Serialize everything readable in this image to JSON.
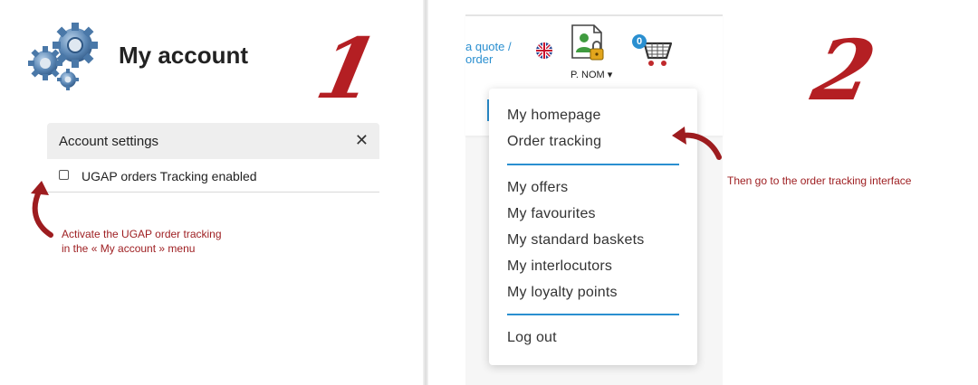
{
  "panel1": {
    "step_number": "1",
    "title": "My account",
    "settings": {
      "header": "Account settings",
      "close_symbol": "✕",
      "option_label": "UGAP orders Tracking enabled",
      "option_checked": false
    },
    "annotation_line1": "Activate the UGAP order tracking",
    "annotation_line2": "in the « My account » menu"
  },
  "panel2": {
    "step_number": "2",
    "header": {
      "quote_link_line1": "a quote /",
      "quote_link_line2": "order",
      "user_name": "P. NOM ▾",
      "cart_count": "0"
    },
    "menu": {
      "group1": [
        "My homepage",
        "Order tracking"
      ],
      "group2": [
        "My offers",
        "My favourites",
        "My standard baskets",
        "My interlocutors",
        "My loyalty points"
      ],
      "group3": [
        "Log out"
      ]
    },
    "annotation": "Then go to the order tracking interface"
  },
  "colors": {
    "accent_red": "#b41f23",
    "annotation_red": "#9d1c1f",
    "link_blue": "#2a8fd0"
  },
  "icons": [
    "gears-icon",
    "close-icon",
    "uk-flag-icon",
    "user-lock-icon",
    "cart-icon",
    "curved-arrow-icon"
  ]
}
